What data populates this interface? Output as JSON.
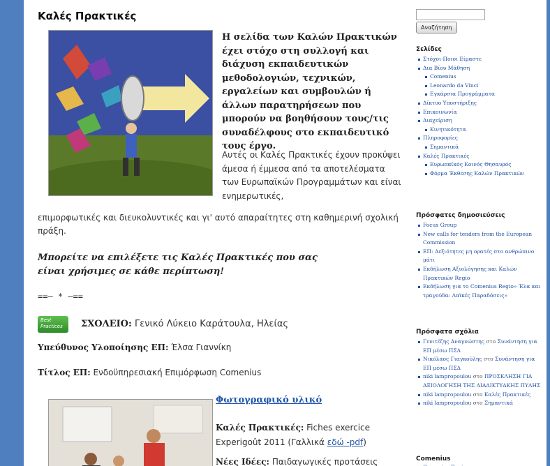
{
  "post": {
    "title": "Καλές Πρακτικές",
    "intro_bold": "Η σελίδα των Καλών Πρακτικών έχει στόχο στη συλλογή και διάχυση εκπαιδευτικών μεθοδολογιών, τεχνικών, εργαλείων και συμβουλών ή άλλων παρατηρήσεων που μπορούν να βοηθήσουν τους/τις συναδέλφους στο εκπαιδευτικό τους έργο.",
    "intro_normal": "Αυτές οι Καλές Πρακτικές έχουν προκύψει άμεσα ή έμμεσα από τα αποτελέσματα των Ευρωπαϊκών Προγραμμάτων και είναι ενημερωτικές,",
    "intro_continued": "επιμορφωτικές και διευκολυντικές και γι' αυτό απαραίτητες στη καθημερινή σχολική πράξη.",
    "italic_note": "Μπορείτε να επιλέξετε τις Καλές Πρακτικές που σας είναι χρήσιμες σε κάθε περίπτωση!",
    "separator": "==– * –==",
    "badge_text": "Best Practices",
    "school_label": "ΣΧΟΛΕΙΟ:",
    "school_value": "Γενικό Λύκειο Καράτουλα, Ηλείας",
    "responsible_label": "Υπεύθυνος Υλοποίησης ΕΠ:",
    "responsible_value": "Έλσα Γιαννίκη",
    "title_label": "Τίτλος ΕΠ:",
    "title_value": "Ενδοϋπηρεσιακή Επιμόρφωση Comenius",
    "photo_link": "Φωτογραφικό υλικό",
    "gp_label": "Καλές Πρακτικές:",
    "gp_value": "Fiches exercice Experigoût 2011 (Γαλλικά",
    "gp_link": "εδώ -pdf",
    "gp_close": ")",
    "ideas_label": "Νέες Ιδέες:",
    "ideas_value": "Παιδαγωγικές προτάσεις"
  },
  "sidebar": {
    "search_button": "Αναζήτηση",
    "pages_heading": "Σελίδες",
    "pages": [
      {
        "label": "Στόχοι-Ποιοι Είμαστε",
        "sub": false
      },
      {
        "label": "Δια Βίου Μάθηση",
        "sub": false
      },
      {
        "label": "Comenius",
        "sub": true
      },
      {
        "label": "Leonardo da Vinci",
        "sub": true
      },
      {
        "label": "Εγκάρσια Προγράμματα",
        "sub": true
      },
      {
        "label": "Δίκτυο Υποστήριξης",
        "sub": false
      },
      {
        "label": "Επικοινωνία",
        "sub": false
      },
      {
        "label": "Διαχείριση",
        "sub": false
      },
      {
        "label": "Κινητικότητα",
        "sub": true
      },
      {
        "label": "Πληροφορίες",
        "sub": false
      },
      {
        "label": "Σημαντικά",
        "sub": true
      },
      {
        "label": "Καλές Πρακτικές",
        "sub": false
      },
      {
        "label": "Ευρωπαϊκός Κοινός Θησαυρός",
        "sub": true
      },
      {
        "label": "Φόρμα Έκθεσης Καλών Πρακτικών",
        "sub": true
      }
    ],
    "recent_heading": "Πρόσφατες δημοσιεύσεις",
    "recent": [
      "Focus Group",
      "New calls for tenders from the European Commission",
      "ΕΠ: Δεξιότητες μη ορατές στο ανθρώπινο μάτι",
      "Εκδήλωση Αξιολόγησης και Καλών Πρακτικών Regio",
      "Εκδήλωση για το Comenius Regio» Έλα και τραγούδα: Λαϊκές Παραδόσεις»"
    ],
    "comments_heading": "Πρόσφατα σχόλια",
    "comments": [
      {
        "author": "Γενιτέζης Αναγνώστης",
        "sep": "στο",
        "post": "Συνάντηση για ΕΠ μέσω ΠΣΔ"
      },
      {
        "author": "Νικόλαος Γιαγκούλης",
        "sep": "στο",
        "post": "Συνάντηση για ΕΠ μέσω ΠΣΔ"
      },
      {
        "author": "niki lampropoulou",
        "sep": "στο",
        "post": "ΠΡΟΣΚΛΗΣΗ ΓΙΑ ΑΞΙΟΛΟΓΗΣΗ ΤΗΣ ΔΙΑΔΙΚΤΥΑΚΗΣ ΠΥΛΗΣ"
      },
      {
        "author": "niki lampropoulou",
        "sep": "στο",
        "post": "Καλές Πρακτικές"
      },
      {
        "author": "niki lampropoulou",
        "sep": "στο",
        "post": "Σημαντικά"
      }
    ],
    "comenius_heading": "Comenius",
    "comenius": [
      "Comenius Regio"
    ]
  }
}
